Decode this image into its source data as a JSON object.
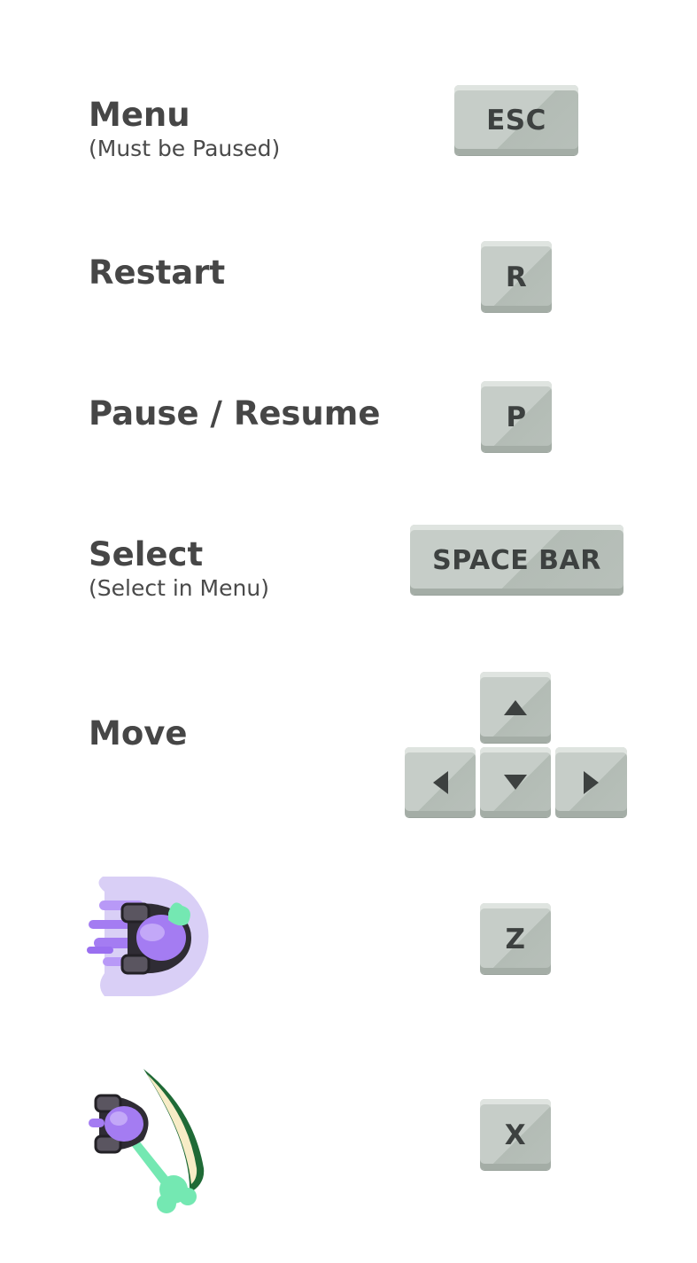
{
  "controls": {
    "menu": {
      "label": "Menu",
      "note": "(Must be Paused)",
      "key": "ESC"
    },
    "restart": {
      "label": "Restart",
      "key": "R"
    },
    "pause": {
      "label": "Pause / Resume",
      "key": "P"
    },
    "select": {
      "label": "Select",
      "note": "(Select in Menu)",
      "key": "SPACE BAR"
    },
    "move": {
      "label": "Move",
      "keys": [
        "up-arrow",
        "left-arrow",
        "down-arrow",
        "right-arrow"
      ]
    },
    "dash": {
      "icon": "dash-ability-sprite",
      "key": "Z"
    },
    "slash": {
      "icon": "slash-ability-sprite",
      "key": "X"
    }
  },
  "colors": {
    "label_text": "#464646",
    "key_face": "#c6cdc8",
    "key_text": "#3d4140",
    "sprite_purple": "#a47cf2",
    "sprite_aura": "#d9cff6",
    "sprite_green": "#74e8b2",
    "blade_cream": "#f7ecc6",
    "blade_green": "#1f6a36"
  }
}
